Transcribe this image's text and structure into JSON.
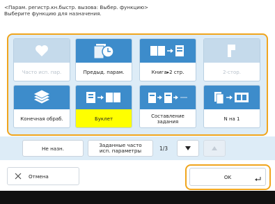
{
  "header": {
    "line1": "<Парам. регистр.кн.быстр. вызова: Выбер. функцию>",
    "line2": "Выберите функцию для назначения."
  },
  "tiles": [
    {
      "label": "Часто исп. пар.",
      "icon": "heart-icon",
      "state": "disabled"
    },
    {
      "label": "Предыд. парам.",
      "icon": "history-icon",
      "state": "enabled"
    },
    {
      "label": "Книга▸2 стр.",
      "icon": "book-to-two-pages-icon",
      "state": "enabled"
    },
    {
      "label": "2-стор.",
      "icon": "two-sided-icon",
      "state": "disabled"
    },
    {
      "label": "Конечная обраб.",
      "icon": "finishing-icon",
      "state": "enabled"
    },
    {
      "label": "Буклет",
      "icon": "booklet-icon",
      "state": "selected"
    },
    {
      "label": "Составление задания",
      "icon": "job-build-icon",
      "state": "enabled"
    },
    {
      "label": "N на 1",
      "icon": "n-on-1-icon",
      "state": "enabled"
    }
  ],
  "nav": {
    "not_assigned": "Не назн.",
    "frequent_line1": "Заданные часто",
    "frequent_line2": "исп. параметры",
    "page": "1/3"
  },
  "footer": {
    "cancel": "Отмена",
    "ok": "OK"
  },
  "colors": {
    "accent_orange": "#f0a51d",
    "icon_blue": "#3d8ccb",
    "selected_yellow": "#ffff00",
    "panel_bg": "#ddecf7"
  }
}
